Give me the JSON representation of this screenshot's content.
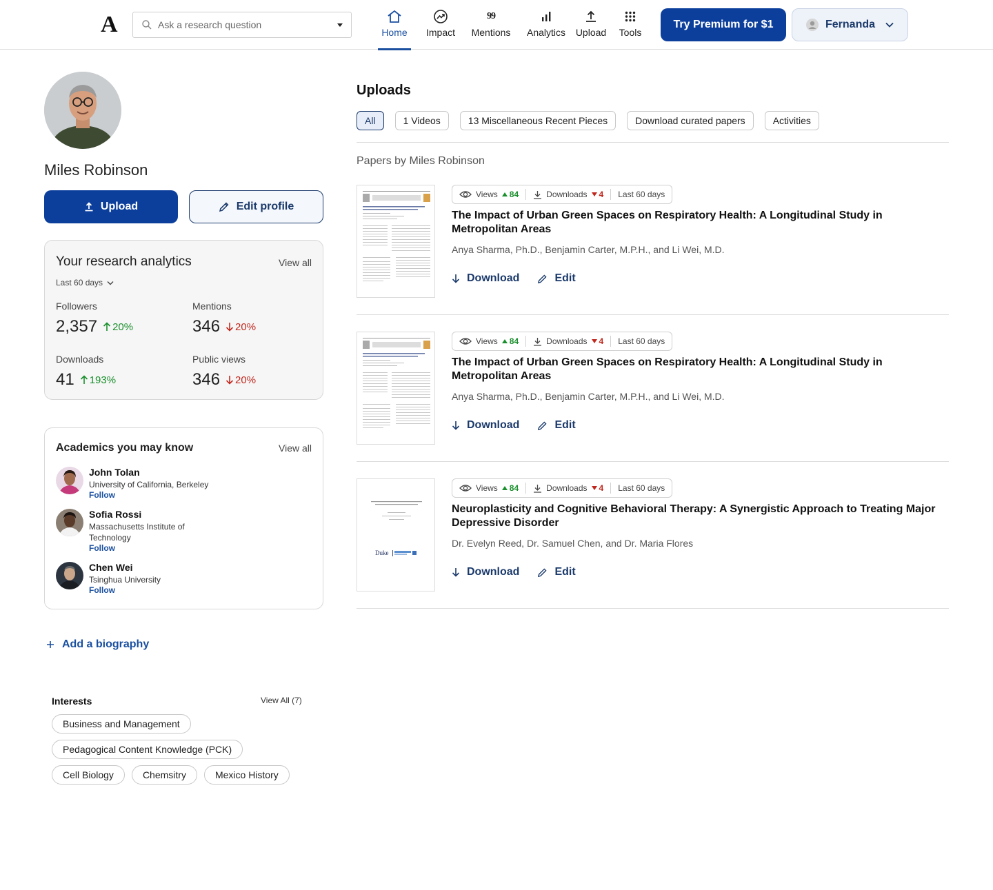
{
  "header": {
    "logo": "A",
    "search_placeholder": "Ask a research question",
    "nav": [
      {
        "label": "Home",
        "icon": "home-icon",
        "active": true
      },
      {
        "label": "Impact",
        "icon": "impact-icon"
      },
      {
        "label": "Mentions",
        "icon": "quote-icon"
      },
      {
        "label": "Analytics",
        "icon": "bar-chart-icon"
      },
      {
        "label": "Upload",
        "icon": "upload-icon"
      },
      {
        "label": "Tools",
        "icon": "grid-icon"
      }
    ],
    "premium_label": "Try Premium for $1",
    "user_name": "Fernanda"
  },
  "profile": {
    "name": "Miles Robinson",
    "upload_label": "Upload",
    "edit_label": "Edit profile"
  },
  "analytics": {
    "title": "Your research analytics",
    "view_all": "View all",
    "period": "Last 60 days",
    "stats": [
      {
        "label": "Followers",
        "value": "2,357",
        "change": "20%",
        "direction": "up"
      },
      {
        "label": "Mentions",
        "value": "346",
        "change": "20%",
        "direction": "down"
      },
      {
        "label": "Downloads",
        "value": "41",
        "change": "193%",
        "direction": "up"
      },
      {
        "label": "Public views",
        "value": "346",
        "change": "20%",
        "direction": "down"
      }
    ]
  },
  "academics": {
    "title": "Academics you may know",
    "view_all": "View all",
    "people": [
      {
        "name": "John Tolan",
        "affiliation": "University of California, Berkeley",
        "follow": "Follow"
      },
      {
        "name": "Sofia Rossi",
        "affiliation": "Massachusetts Institute of Technology",
        "follow": "Follow"
      },
      {
        "name": "Chen Wei",
        "affiliation": "Tsinghua University",
        "follow": "Follow"
      }
    ]
  },
  "biography": {
    "add_label": "Add a biography"
  },
  "interests": {
    "title": "Interests",
    "view_all": "View All (7)",
    "items": [
      "Business and Management",
      "Pedagogical Content Knowledge (PCK)",
      "Cell Biology",
      "Chemsitry",
      "Mexico History"
    ]
  },
  "uploads": {
    "title": "Uploads",
    "tabs": [
      "All",
      "1 Videos",
      "13 Miscellaneous Recent Pieces",
      "Download curated papers",
      "Activities"
    ],
    "active_tab": "All",
    "papers_heading": "Papers by Miles Robinson",
    "papers": [
      {
        "views_label": "Views",
        "views": "84",
        "downloads_label": "Downloads",
        "downloads": "4",
        "period": "Last 60 days",
        "title": "The Impact of Urban Green Spaces on Respiratory Health: A Longitudinal Study in Metropolitan Areas",
        "authors": "Anya Sharma, Ph.D., Benjamin Carter, M.P.H., and Li Wei, M.D.",
        "download_label": "Download",
        "edit_label": "Edit"
      },
      {
        "views_label": "Views",
        "views": "84",
        "downloads_label": "Downloads",
        "downloads": "4",
        "period": "Last 60 days",
        "title": "The Impact of Urban Green Spaces on Respiratory Health: A Longitudinal Study in Metropolitan Areas",
        "authors": "Anya Sharma, Ph.D., Benjamin Carter, M.P.H., and Li Wei, M.D.",
        "download_label": "Download",
        "edit_label": "Edit"
      },
      {
        "views_label": "Views",
        "views": "84",
        "downloads_label": "Downloads",
        "downloads": "4",
        "period": "Last 60 days",
        "title": "Neuroplasticity and Cognitive Behavioral Therapy: A Synergistic Approach to Treating Major Depressive Disorder",
        "authors": "Dr. Evelyn Reed, Dr. Samuel Chen, and Dr. Maria Flores",
        "download_label": "Download",
        "edit_label": "Edit",
        "thumb_text": "Duke"
      }
    ]
  },
  "colors": {
    "brand": "#0c3f9c",
    "link": "#1a4fa0",
    "up": "#1a8f2c",
    "down": "#c0281e"
  }
}
